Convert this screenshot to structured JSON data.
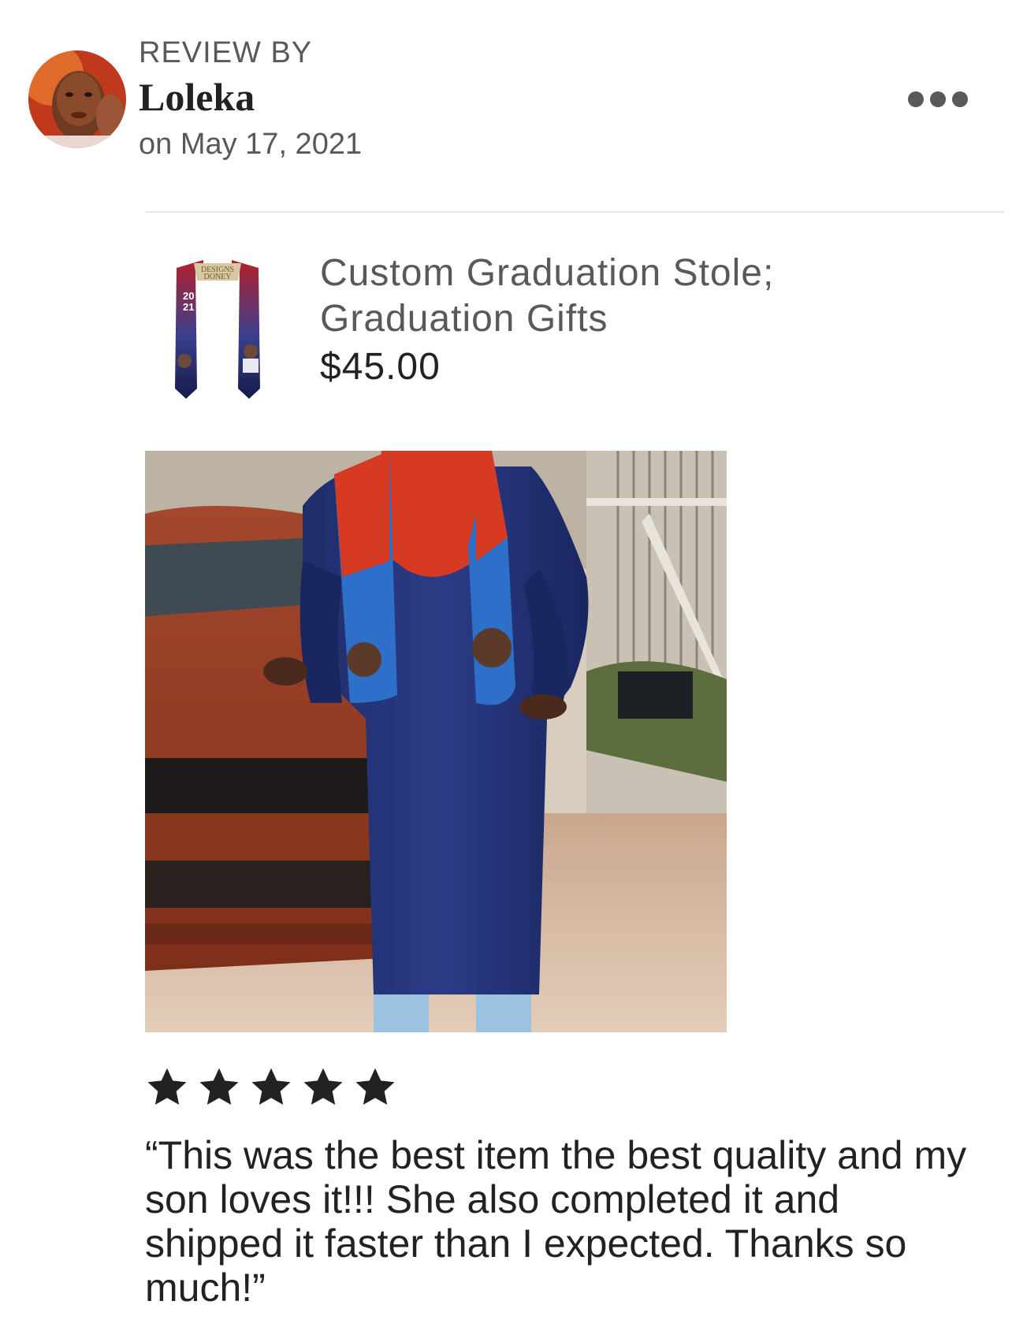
{
  "header": {
    "review_by_label": "REVIEW BY",
    "reviewer_name": "Loleka",
    "review_date": "on May 17, 2021",
    "more_icon": "more-horizontal-icon"
  },
  "listing": {
    "title": "Custom Graduation Stole; Graduation Gifts",
    "price": "$45.00",
    "thumbnail_text": [
      "DESIGNS",
      "DONEY",
      "20",
      "21"
    ]
  },
  "review": {
    "rating": 5,
    "rating_max": 5,
    "star_icon": "star-icon",
    "text": "“This was the best item the best quality and my son loves it!!! She also completed it and shipped it faster than I expected. Thanks so much!”"
  },
  "colors": {
    "primary_text": "#222222",
    "secondary_text": "#595959",
    "divider": "#e6e6e6",
    "star": "#222222"
  }
}
